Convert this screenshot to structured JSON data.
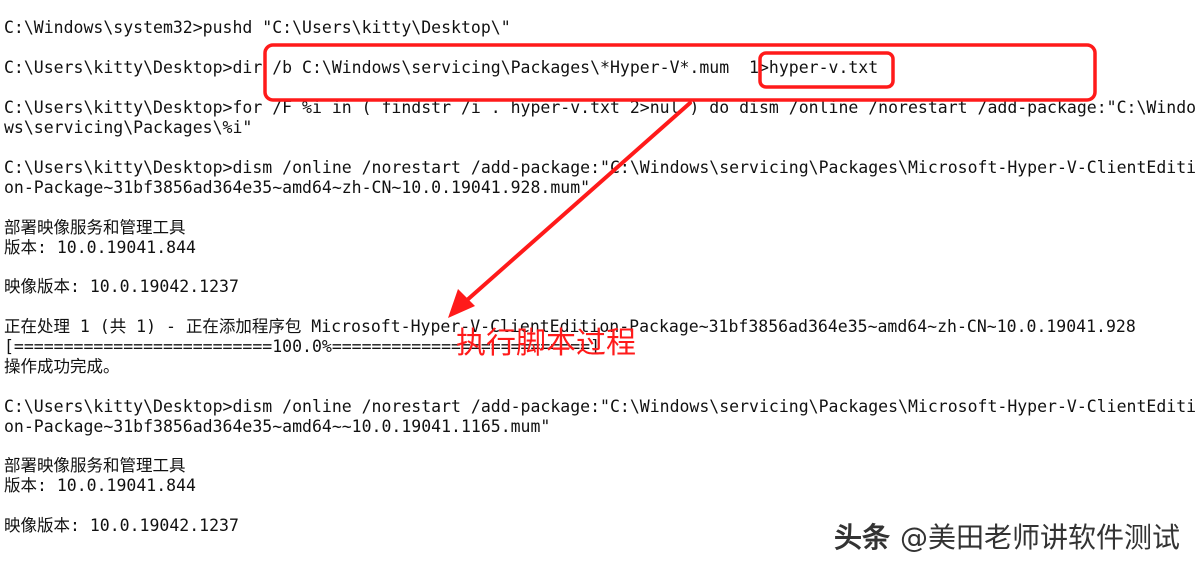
{
  "console": {
    "lines": [
      "C:\\Windows\\system32>pushd \"C:\\Users\\kitty\\Desktop\\\"",
      "",
      "C:\\Users\\kitty\\Desktop>dir /b C:\\Windows\\servicing\\Packages\\*Hyper-V*.mum  1>hyper-v.txt",
      "",
      "C:\\Users\\kitty\\Desktop>for /F %i in ( findstr /i . hyper-v.txt 2>nul ) do dism /online /norestart /add-package:\"C:\\Windo",
      "ws\\servicing\\Packages\\%i\"",
      "",
      "C:\\Users\\kitty\\Desktop>dism /online /norestart /add-package:\"C:\\Windows\\servicing\\Packages\\Microsoft-Hyper-V-ClientEditi",
      "on-Package~31bf3856ad364e35~amd64~zh-CN~10.0.19041.928.mum\"",
      "",
      "部署映像服务和管理工具",
      "版本: 10.0.19041.844",
      "",
      "映像版本: 10.0.19042.1237",
      "",
      "正在处理 1 (共 1) - 正在添加程序包 Microsoft-Hyper-V-ClientEdition-Package~31bf3856ad364e35~amd64~zh-CN~10.0.19041.928",
      "[==========================100.0%==========================]",
      "操作成功完成。",
      "",
      "C:\\Users\\kitty\\Desktop>dism /online /norestart /add-package:\"C:\\Windows\\servicing\\Packages\\Microsoft-Hyper-V-ClientEditi",
      "on-Package~31bf3856ad364e35~amd64~~10.0.19041.1165.mum\"",
      "",
      "部署映像服务和管理工具",
      "版本: 10.0.19041.844",
      "",
      "映像版本: 10.0.19042.1237"
    ]
  },
  "annotation": {
    "label": "执行脚本过程",
    "color": "#ff1a1a"
  },
  "watermark": {
    "brand": "头条",
    "handle": "@美田老师讲软件测试"
  }
}
